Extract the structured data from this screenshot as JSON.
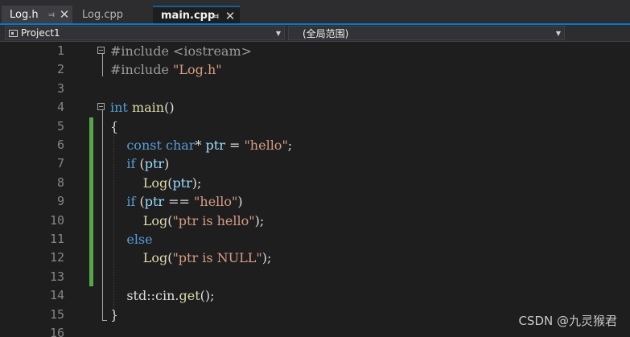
{
  "tabs": [
    {
      "label": "Log.h",
      "active": false
    },
    {
      "label": "Log.cpp",
      "active": false
    },
    {
      "label": "main.cpp",
      "active": true
    }
  ],
  "navbar": {
    "project": "Project1",
    "scope": "(全局范围)"
  },
  "editor": {
    "line_numbers": [
      "1",
      "2",
      "3",
      "4",
      "5",
      "6",
      "7",
      "8",
      "9",
      "10",
      "11",
      "12",
      "13",
      "14",
      "15",
      "16"
    ],
    "lines": [
      [
        {
          "t": "#include <iostream>",
          "c": "pp"
        }
      ],
      [
        {
          "t": "#include ",
          "c": "pp"
        },
        {
          "t": "\"Log.h\"",
          "c": "str"
        }
      ],
      [],
      [
        {
          "t": "int",
          "c": "kw"
        },
        {
          "t": " ",
          "c": "pl"
        },
        {
          "t": "main",
          "c": "fn"
        },
        {
          "t": "()",
          "c": "pl"
        }
      ],
      [
        {
          "t": "{",
          "c": "pl"
        }
      ],
      [
        {
          "t": "    ",
          "c": "pl"
        },
        {
          "t": "const",
          "c": "kw"
        },
        {
          "t": " ",
          "c": "pl"
        },
        {
          "t": "char",
          "c": "kw"
        },
        {
          "t": "* ",
          "c": "pl"
        },
        {
          "t": "ptr",
          "c": "var"
        },
        {
          "t": " = ",
          "c": "pl"
        },
        {
          "t": "\"hello\"",
          "c": "str"
        },
        {
          "t": ";",
          "c": "pl"
        }
      ],
      [
        {
          "t": "    ",
          "c": "pl"
        },
        {
          "t": "if",
          "c": "kw"
        },
        {
          "t": " (",
          "c": "pl"
        },
        {
          "t": "ptr",
          "c": "var"
        },
        {
          "t": ")",
          "c": "pl"
        }
      ],
      [
        {
          "t": "        ",
          "c": "pl"
        },
        {
          "t": "Log",
          "c": "fn"
        },
        {
          "t": "(",
          "c": "pl"
        },
        {
          "t": "ptr",
          "c": "var"
        },
        {
          "t": ");",
          "c": "pl"
        }
      ],
      [
        {
          "t": "    ",
          "c": "pl"
        },
        {
          "t": "if",
          "c": "kw"
        },
        {
          "t": " (",
          "c": "pl"
        },
        {
          "t": "ptr",
          "c": "var"
        },
        {
          "t": " == ",
          "c": "pl"
        },
        {
          "t": "\"hello\"",
          "c": "str"
        },
        {
          "t": ")",
          "c": "pl"
        }
      ],
      [
        {
          "t": "        ",
          "c": "pl"
        },
        {
          "t": "Log",
          "c": "fn"
        },
        {
          "t": "(",
          "c": "pl"
        },
        {
          "t": "\"ptr is hello\"",
          "c": "str"
        },
        {
          "t": ");",
          "c": "pl"
        }
      ],
      [
        {
          "t": "    ",
          "c": "pl"
        },
        {
          "t": "else",
          "c": "kw"
        }
      ],
      [
        {
          "t": "        ",
          "c": "pl"
        },
        {
          "t": "Log",
          "c": "fn"
        },
        {
          "t": "(",
          "c": "pl"
        },
        {
          "t": "\"ptr is NULL\"",
          "c": "str"
        },
        {
          "t": ");",
          "c": "pl"
        }
      ],
      [],
      [
        {
          "t": "    std::cin.",
          "c": "pl"
        },
        {
          "t": "get",
          "c": "fn"
        },
        {
          "t": "();",
          "c": "pl"
        }
      ],
      [
        {
          "t": "}",
          "c": "pl"
        }
      ],
      []
    ]
  },
  "watermark": "CSDN @九灵猴君",
  "colors": {
    "background": "#1e1e1e",
    "keyword": "#569cd6",
    "string": "#d69d85",
    "function": "#dcdcaa",
    "variable": "#9cdcfe",
    "preprocessor": "#9b9b9b",
    "line_number": "#858585",
    "change_marker": "#57a64a",
    "accent": "#007acc"
  }
}
